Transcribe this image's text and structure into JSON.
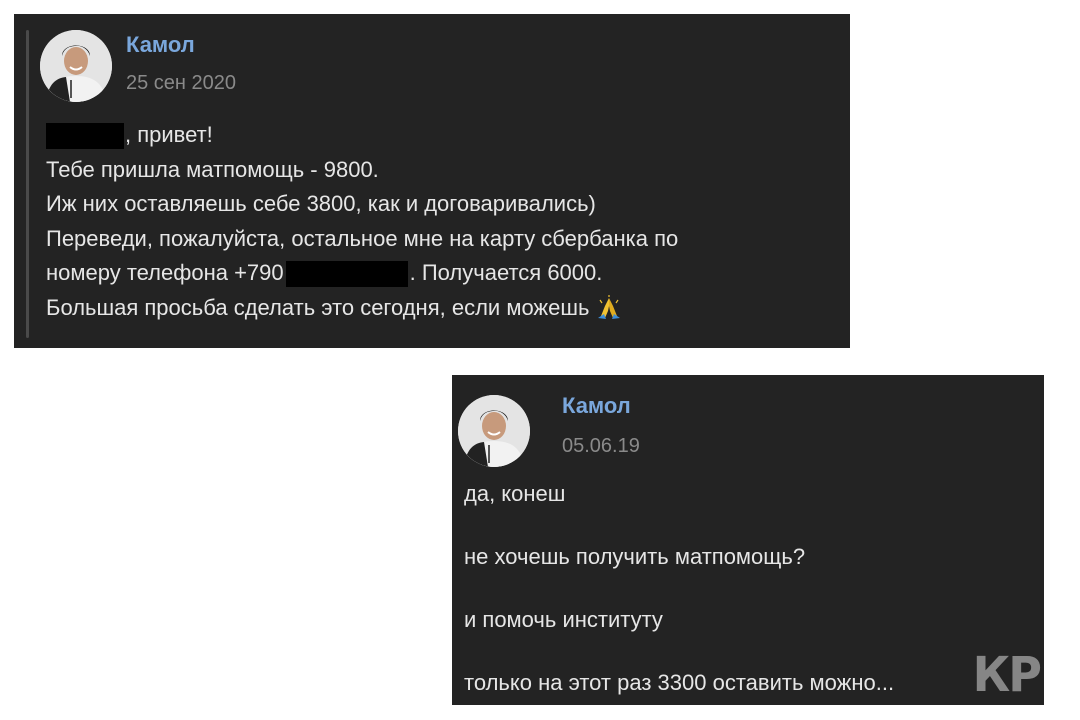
{
  "message1": {
    "author": "Камол",
    "date": "25 сен 2020",
    "greeting_suffix": ", привет!",
    "line2": "Тебе пришла матпомощь - 9800.",
    "line3": "Иж них оставляешь себе 3800, как и договаривались)",
    "line4": "Переведи, пожалуйста, остальное мне на карту сбербанка по",
    "line5_prefix": "номеру телефона +790",
    "line5_suffix": ". Получается 6000.",
    "line6": "Большая просьба сделать это сегодня, если можешь",
    "emoji": "folded-hands-icon"
  },
  "message2": {
    "author": "Камол",
    "date": "05.06.19",
    "lines": [
      "да, конеш",
      "не хочешь получить матпомощь?",
      "и помочь институту",
      "только на этот раз 3300 оставить можно..."
    ]
  },
  "watermark": "КР",
  "colors": {
    "panel_bg": "#232323",
    "author": "#7aa7dc",
    "date": "#8a8a8a",
    "text": "#e6e6e6",
    "redaction": "#000000"
  }
}
